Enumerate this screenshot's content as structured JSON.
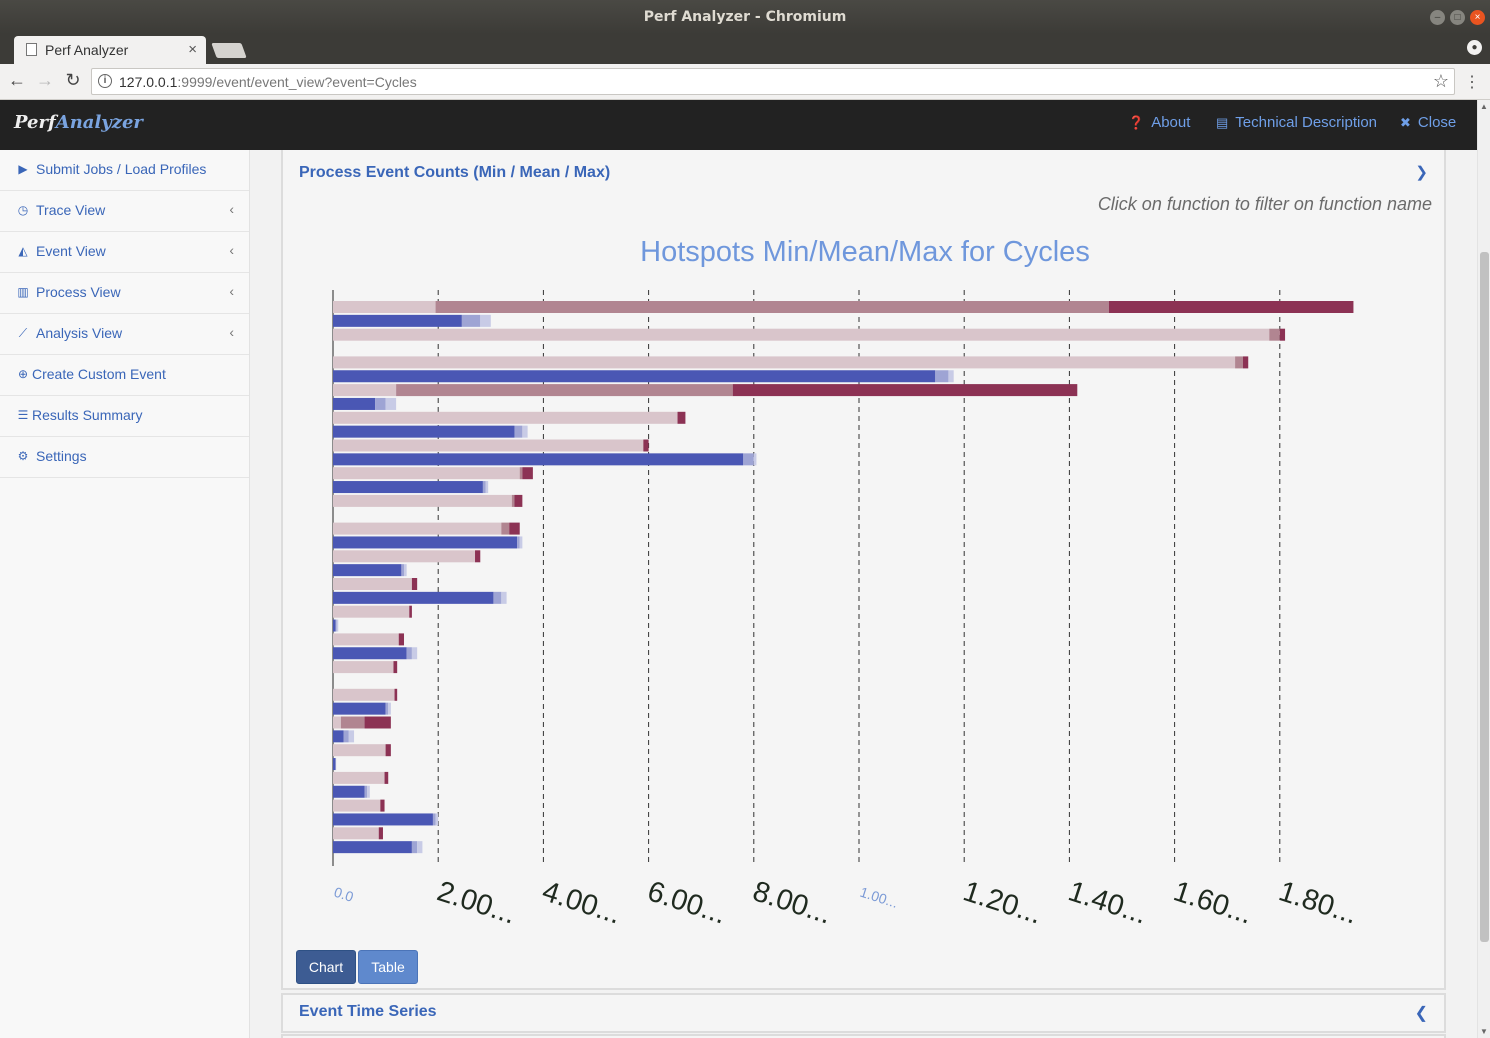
{
  "window": {
    "title": "Perf Analyzer - Chromium"
  },
  "browser": {
    "tab_title": "Perf Analyzer",
    "url_host": "127.0.0.1",
    "url_rest": ":9999/event/event_view?event=Cycles"
  },
  "header": {
    "brand_part1": "Perf",
    "brand_part2": "Analyzer",
    "about": "About",
    "tech": "Technical Description",
    "close": "Close"
  },
  "sidebar": {
    "items": [
      {
        "label": "Submit Jobs / Load Profiles",
        "icon": "play-icon"
      },
      {
        "label": "Trace View",
        "icon": "clock-icon"
      },
      {
        "label": "Event View",
        "icon": "area-chart-icon"
      },
      {
        "label": "Process View",
        "icon": "bar-chart-icon"
      },
      {
        "label": "Analysis View",
        "icon": "line-chart-icon"
      },
      {
        "label": "Create Custom Event",
        "icon": "plus-circle-icon"
      },
      {
        "label": "Results Summary",
        "icon": "list-icon"
      },
      {
        "label": "Settings",
        "icon": "gear-icon"
      }
    ]
  },
  "panel": {
    "title": "Process Event Counts (Min / Mean / Max)",
    "hint": "Click on function to filter on function name",
    "btn_chart": "Chart",
    "btn_table": "Table"
  },
  "panel2": {
    "title": "Event Time Series"
  },
  "colors": {
    "process_min": "#d9c5cb",
    "process_mean": "#b18591",
    "process_max": "#8c3254",
    "thread_min": "#4a57b4",
    "thread_mean": "#9ea4d4",
    "thread_max": "#c8cbe6",
    "accent": "#3a66b8"
  },
  "chart_data": {
    "type": "bar",
    "orientation": "horizontal-stacked",
    "title": "Hotspots Min/Mean/Max for Cycles",
    "x_tick_labels": [
      "0.0",
      "2.00...",
      "4.00...",
      "6.00...",
      "8.00...",
      "1.00...",
      "1.20...",
      "1.40...",
      "1.60...",
      "1.80..."
    ],
    "x_ticks": [
      0,
      2,
      4,
      6,
      8,
      10,
      12,
      14,
      16,
      18
    ],
    "xlim": [
      0,
      19.5
    ],
    "grid": "vertical-dashed",
    "bars": [
      {
        "kind": "process",
        "min": 1.95,
        "mean": 14.75,
        "max": 19.4
      },
      {
        "kind": "thread",
        "min": 2.45,
        "mean": 2.8,
        "max": 3.0
      },
      {
        "kind": "process",
        "min": 17.8,
        "mean": 18.0,
        "max": 18.1
      },
      {
        "kind": "none"
      },
      {
        "kind": "process",
        "min": 17.15,
        "mean": 17.3,
        "max": 17.4
      },
      {
        "kind": "thread",
        "min": 11.45,
        "mean": 11.7,
        "max": 11.8
      },
      {
        "kind": "process",
        "min": 1.2,
        "mean": 7.6,
        "max": 14.15
      },
      {
        "kind": "thread",
        "min": 0.8,
        "mean": 1.0,
        "max": 1.2
      },
      {
        "kind": "process",
        "min": 6.55,
        "mean": 6.55,
        "max": 6.7
      },
      {
        "kind": "thread",
        "min": 3.45,
        "mean": 3.6,
        "max": 3.7
      },
      {
        "kind": "process",
        "min": 5.9,
        "mean": 5.9,
        "max": 6.0
      },
      {
        "kind": "thread",
        "min": 7.8,
        "mean": 8.0,
        "max": 8.05
      },
      {
        "kind": "process",
        "min": 3.55,
        "mean": 3.6,
        "max": 3.8
      },
      {
        "kind": "thread",
        "min": 2.85,
        "mean": 2.9,
        "max": 2.95
      },
      {
        "kind": "process",
        "min": 3.4,
        "mean": 3.45,
        "max": 3.6
      },
      {
        "kind": "none"
      },
      {
        "kind": "process",
        "min": 3.2,
        "mean": 3.35,
        "max": 3.55
      },
      {
        "kind": "thread",
        "min": 3.5,
        "mean": 3.55,
        "max": 3.6
      },
      {
        "kind": "process",
        "min": 2.7,
        "mean": 2.7,
        "max": 2.8
      },
      {
        "kind": "thread",
        "min": 1.3,
        "mean": 1.35,
        "max": 1.4
      },
      {
        "kind": "process",
        "min": 1.5,
        "mean": 1.5,
        "max": 1.6
      },
      {
        "kind": "thread",
        "min": 3.05,
        "mean": 3.2,
        "max": 3.3
      },
      {
        "kind": "process",
        "min": 1.45,
        "mean": 1.45,
        "max": 1.5
      },
      {
        "kind": "thread",
        "min": 0.05,
        "mean": 0.07,
        "max": 0.1
      },
      {
        "kind": "process",
        "min": 1.25,
        "mean": 1.25,
        "max": 1.35
      },
      {
        "kind": "thread",
        "min": 1.4,
        "mean": 1.5,
        "max": 1.6
      },
      {
        "kind": "process",
        "min": 1.15,
        "mean": 1.15,
        "max": 1.22
      },
      {
        "kind": "none"
      },
      {
        "kind": "process",
        "min": 1.17,
        "mean": 1.17,
        "max": 1.22
      },
      {
        "kind": "thread",
        "min": 1.0,
        "mean": 1.05,
        "max": 1.1
      },
      {
        "kind": "process",
        "min": 0.15,
        "mean": 0.6,
        "max": 1.1
      },
      {
        "kind": "thread",
        "min": 0.2,
        "mean": 0.3,
        "max": 0.4
      },
      {
        "kind": "process",
        "min": 1.0,
        "mean": 1.0,
        "max": 1.1
      },
      {
        "kind": "thread",
        "min": 0.05,
        "mean": 0.05,
        "max": 0.06
      },
      {
        "kind": "process",
        "min": 0.98,
        "mean": 0.98,
        "max": 1.05
      },
      {
        "kind": "thread",
        "min": 0.6,
        "mean": 0.65,
        "max": 0.7
      },
      {
        "kind": "process",
        "min": 0.9,
        "mean": 0.9,
        "max": 0.98
      },
      {
        "kind": "thread",
        "min": 1.9,
        "mean": 1.95,
        "max": 2.0
      },
      {
        "kind": "process",
        "min": 0.87,
        "mean": 0.87,
        "max": 0.95
      },
      {
        "kind": "thread",
        "min": 1.5,
        "mean": 1.6,
        "max": 1.7
      }
    ]
  }
}
